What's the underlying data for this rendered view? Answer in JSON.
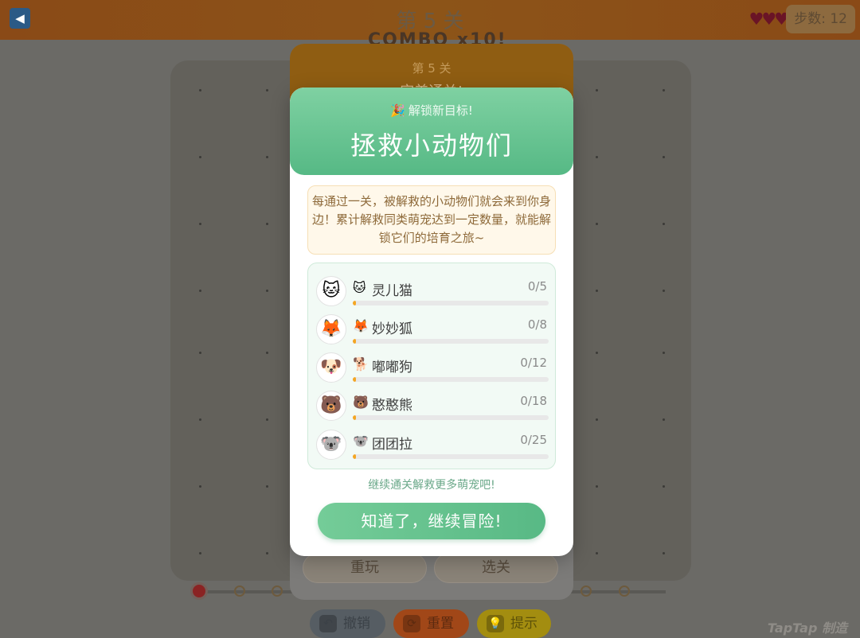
{
  "topbar": {
    "back_icon": "◀",
    "level_title": "第 5 关",
    "hearts": "♥♥♥",
    "steps_label": "步数: 12"
  },
  "combo_text": "COMBO x10!",
  "board_colors": {
    "board": "#63615b",
    "dot": "#3b3a37"
  },
  "bottom_bar": {
    "undo_label": "撤销",
    "reset_label": "重置",
    "hint_label": "提示",
    "undo_icon": "↶",
    "reset_icon": "⟳",
    "hint_icon": "💡"
  },
  "watermark": "TapTap 制造",
  "back_card": {
    "level_label": "第 5 关",
    "subtitle": "完美通关!",
    "replay_label": "重玩",
    "select_label": "选关"
  },
  "modal": {
    "unlock_icon": "🎉",
    "unlock_text": "解锁新目标!",
    "title": "拯救小动物们",
    "description": "每通过一关，被解救的小动物们就会来到你身边！累计解救同类萌宠达到一定数量，就能解锁它们的培育之旅~",
    "pets": [
      {
        "avatar": "🐱",
        "emoji": "🐱",
        "name": "灵儿猫",
        "count": "0/5",
        "progress": 0
      },
      {
        "avatar": "🦊",
        "emoji": "🦊",
        "name": "妙妙狐",
        "count": "0/8",
        "progress": 0
      },
      {
        "avatar": "🐶",
        "emoji": "🐕",
        "name": "嘟嘟狗",
        "count": "0/12",
        "progress": 0
      },
      {
        "avatar": "🐻",
        "emoji": "🐻",
        "name": "憨憨熊",
        "count": "0/18",
        "progress": 0
      },
      {
        "avatar": "🐨",
        "emoji": "🐨",
        "name": "团团拉",
        "count": "0/25",
        "progress": 0
      }
    ],
    "footer_hint": "继续通关解救更多萌宠吧!",
    "confirm_label": "知道了，继续冒险!"
  },
  "colors": {
    "accent_green": "#58b985",
    "progress_orange": "#f4a623",
    "desc_text": "#8e6a3a"
  }
}
